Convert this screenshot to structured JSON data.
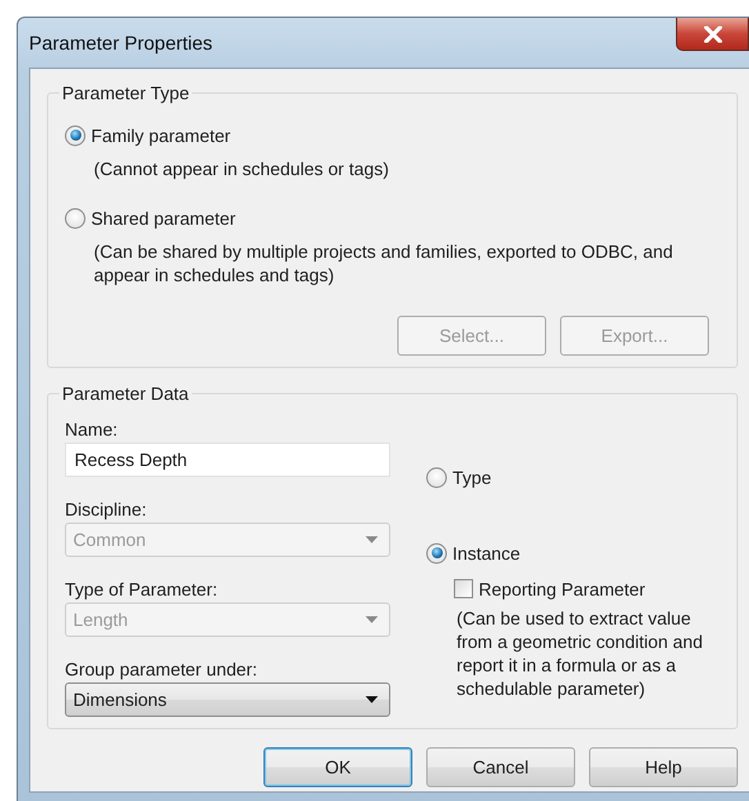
{
  "window": {
    "title": "Parameter Properties"
  },
  "parameter_type": {
    "title": "Parameter Type",
    "options": [
      {
        "label": "Family parameter",
        "note": "(Cannot appear in schedules or tags)",
        "selected": true
      },
      {
        "label": "Shared parameter",
        "note": "(Can be shared by multiple projects and families, exported to ODBC, and appear in schedules and tags)",
        "selected": false
      }
    ],
    "buttons": [
      {
        "label": "Select...",
        "disabled": true
      },
      {
        "label": "Export...",
        "disabled": true
      }
    ]
  },
  "parameter_data": {
    "title": "Parameter Data",
    "fields": [
      {
        "kind": "text",
        "label": "Name:",
        "value": "Recess Depth"
      },
      {
        "kind": "dropdown",
        "label": "Discipline:",
        "value": "Common",
        "disabled": true
      },
      {
        "kind": "dropdown",
        "label": "Type of Parameter:",
        "value": "Length",
        "disabled": true
      },
      {
        "kind": "dropdown",
        "label": "Group parameter under:",
        "value": "Dimensions",
        "disabled": false
      }
    ],
    "scope_options": [
      {
        "label": "Type",
        "selected": false
      },
      {
        "label": "Instance",
        "selected": true
      }
    ],
    "reporting": {
      "label": "Reporting Parameter",
      "checked": false,
      "note": "(Can be used to extract value from a geometric condition and report it in a formula or as a schedulable parameter)"
    }
  },
  "buttons": [
    {
      "label": "OK",
      "default": true
    },
    {
      "label": "Cancel",
      "default": false
    },
    {
      "label": "Help",
      "default": false
    }
  ]
}
